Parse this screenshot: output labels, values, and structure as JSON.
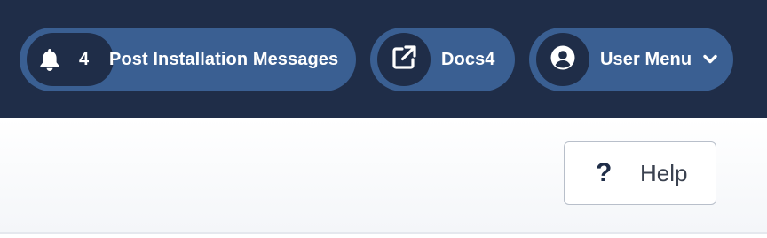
{
  "header": {
    "background": "#1f2d48",
    "pill_color": "#3a5f92",
    "messages": {
      "icon": "bell-icon",
      "count": "4",
      "label": "Post Installation Messages"
    },
    "docs": {
      "icon": "external-link-icon",
      "label": "Docs4"
    },
    "user_menu": {
      "icon": "user-circle-icon",
      "label": "User Menu",
      "chevron_icon": "chevron-down-icon"
    }
  },
  "toolbar": {
    "help": {
      "icon": "question-mark-icon",
      "icon_glyph": "?",
      "label": "Help"
    }
  }
}
